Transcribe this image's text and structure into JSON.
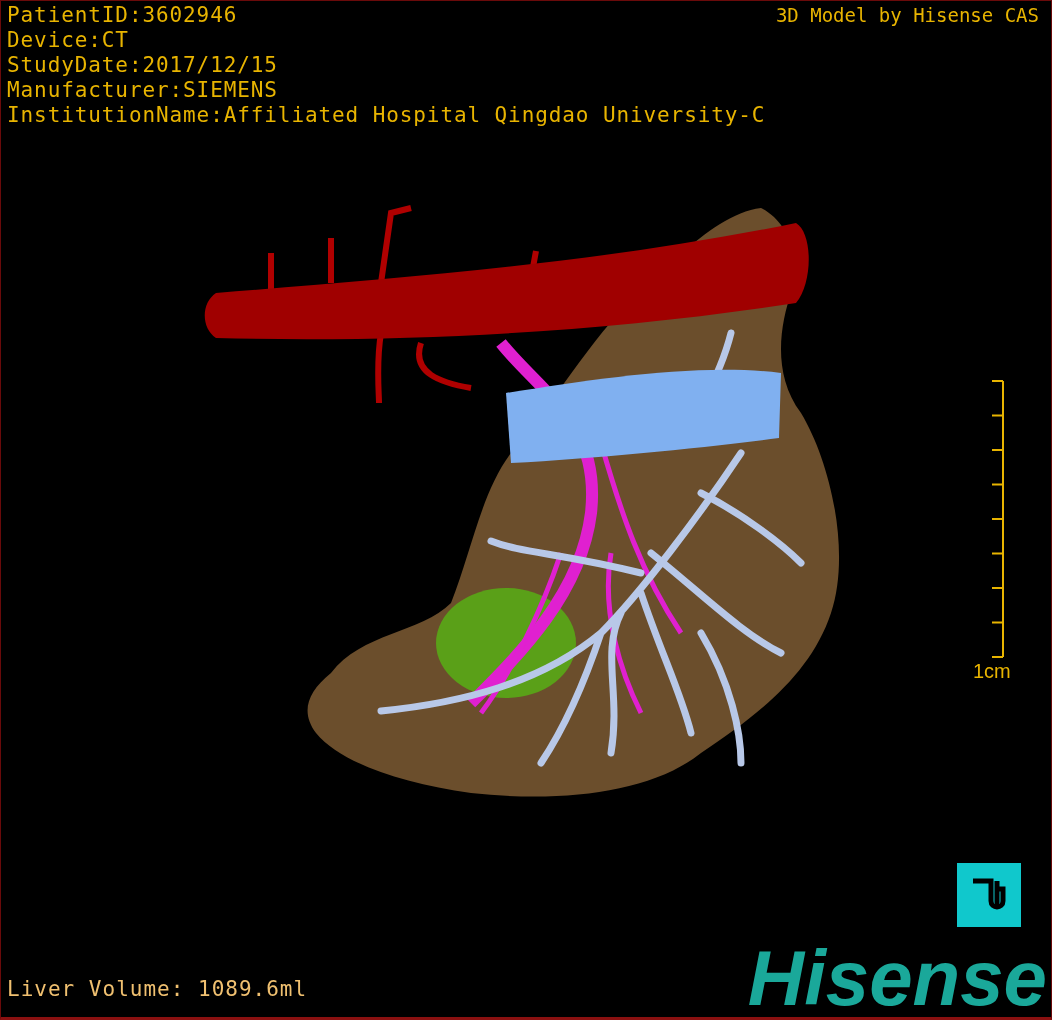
{
  "info_lines": [
    "PatientID:3602946",
    "Device:CT",
    "StudyDate:2017/12/15",
    "Manufacturer:SIEMENS",
    "InstitutionName:Affiliated Hospital Qingdao University-C"
  ],
  "title": "3D Model by Hisense CAS",
  "scale_bar": {
    "label": "1cm"
  },
  "liver_volume": "Liver Volume: 1089.6ml",
  "logo": "Hisense"
}
